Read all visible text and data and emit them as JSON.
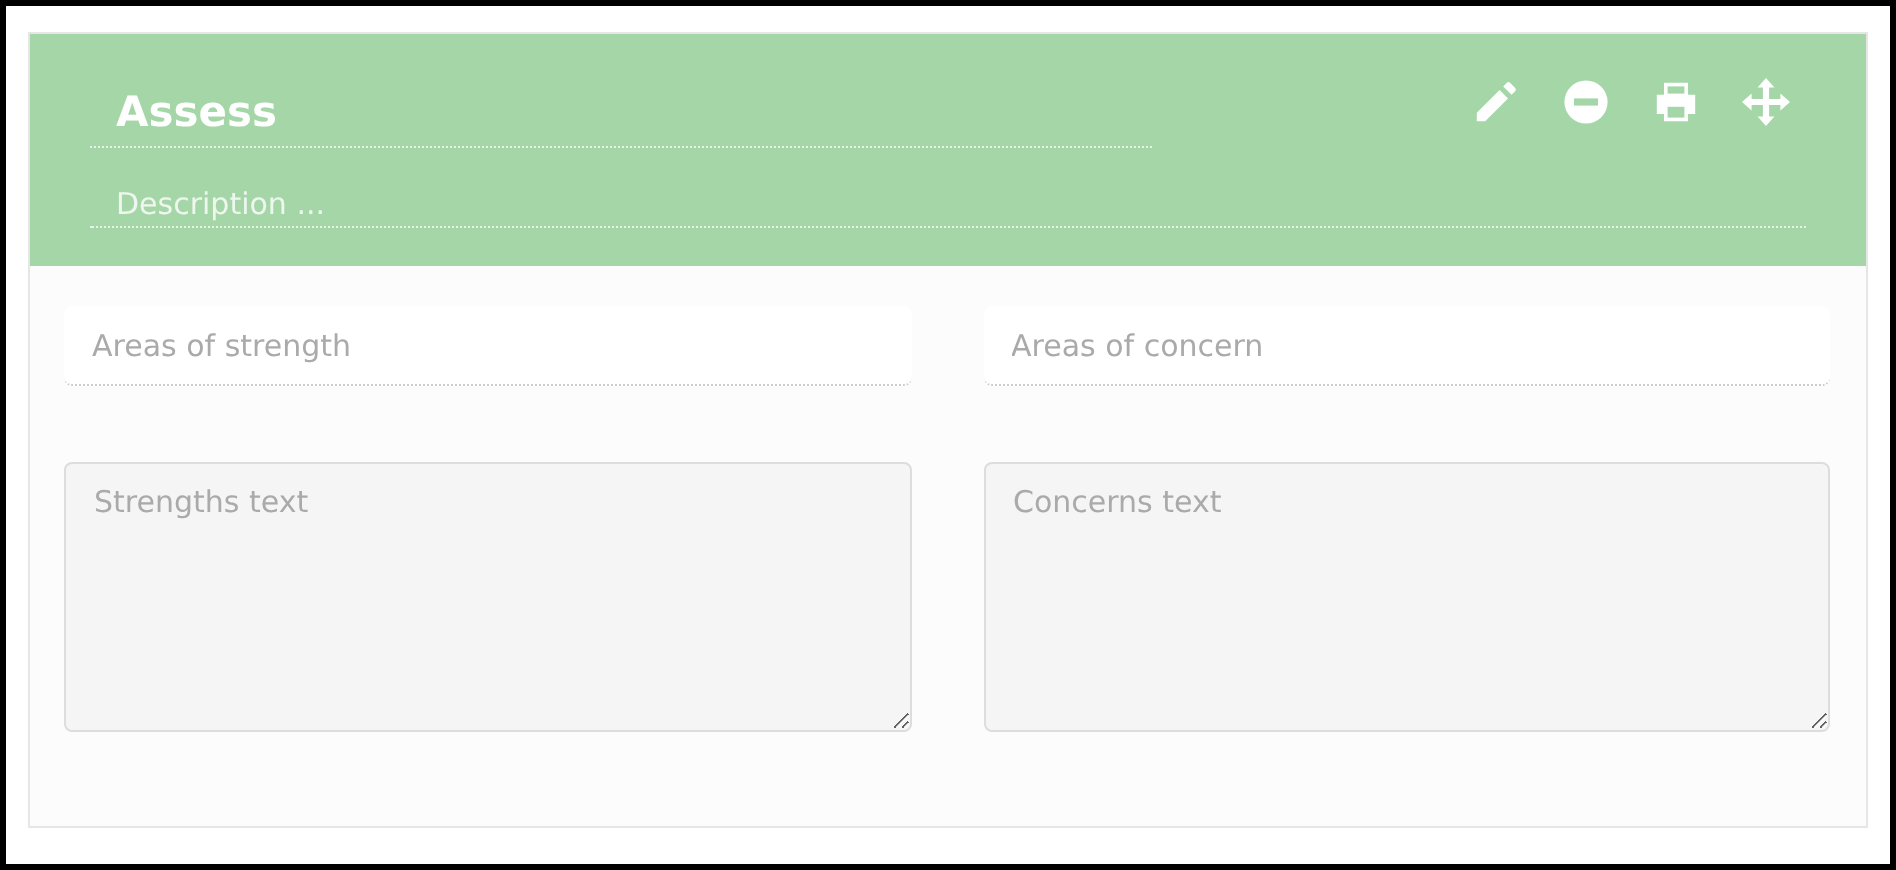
{
  "header": {
    "title": {
      "value": "Assess"
    },
    "description": {
      "placeholder": "Description ..."
    },
    "actions": [
      {
        "kind": "edit"
      },
      {
        "kind": "remove"
      },
      {
        "kind": "print"
      },
      {
        "kind": "move"
      }
    ]
  },
  "columns": [
    {
      "label_field": {
        "placeholder": "Areas of strength"
      },
      "text_area": {
        "placeholder": "Strengths text"
      }
    },
    {
      "label_field": {
        "placeholder": "Areas of concern"
      },
      "text_area": {
        "placeholder": "Concerns text"
      }
    }
  ]
}
